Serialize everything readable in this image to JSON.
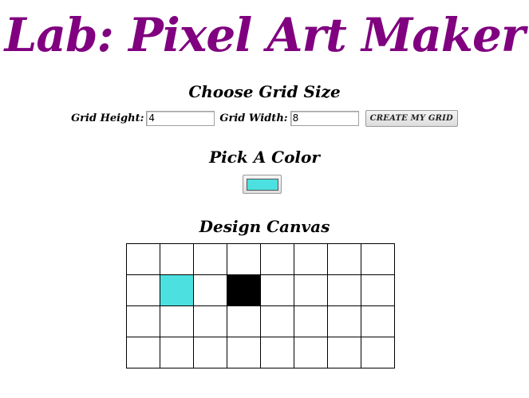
{
  "page": {
    "title": "Lab: Pixel Art Maker"
  },
  "grid_size": {
    "heading": "Choose Grid Size",
    "height_label": "Grid Height:",
    "height_value": "4",
    "width_label": "Grid Width:",
    "width_value": "8",
    "submit_label": "CREATE MY GRID"
  },
  "color": {
    "heading": "Pick A Color",
    "selected": "#4de0e0"
  },
  "canvas": {
    "heading": "Design Canvas",
    "rows": 4,
    "cols": 8,
    "cells": [
      [
        "",
        "",
        "",
        "",
        "",
        "",
        "",
        ""
      ],
      [
        "",
        "#4de0e0",
        "",
        "#000000",
        "",
        "",
        "",
        ""
      ],
      [
        "",
        "",
        "",
        "",
        "",
        "",
        "",
        ""
      ],
      [
        "",
        "",
        "",
        "",
        "",
        "",
        "",
        ""
      ]
    ]
  }
}
